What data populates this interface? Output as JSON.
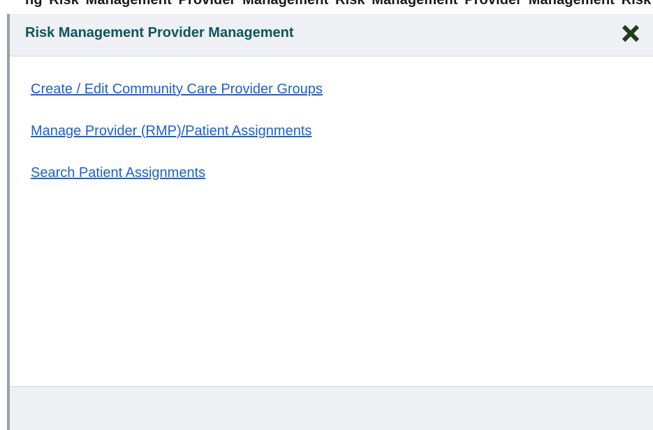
{
  "background_text": "ng Risk Management Provider Management Risk Management Provider Management Risk Management Provider Manag",
  "dialog": {
    "title": "Risk Management Provider Management",
    "close_icon": "close-x-icon",
    "links": [
      "Create / Edit Community Care Provider Groups",
      "Manage Provider (RMP)/Patient Assignments",
      "Search Patient Assignments"
    ]
  },
  "colors": {
    "title": "#0b5560",
    "link": "#1d5fd1",
    "header_bg": "#eef0f3",
    "close_icon": "#1d3d1d"
  }
}
